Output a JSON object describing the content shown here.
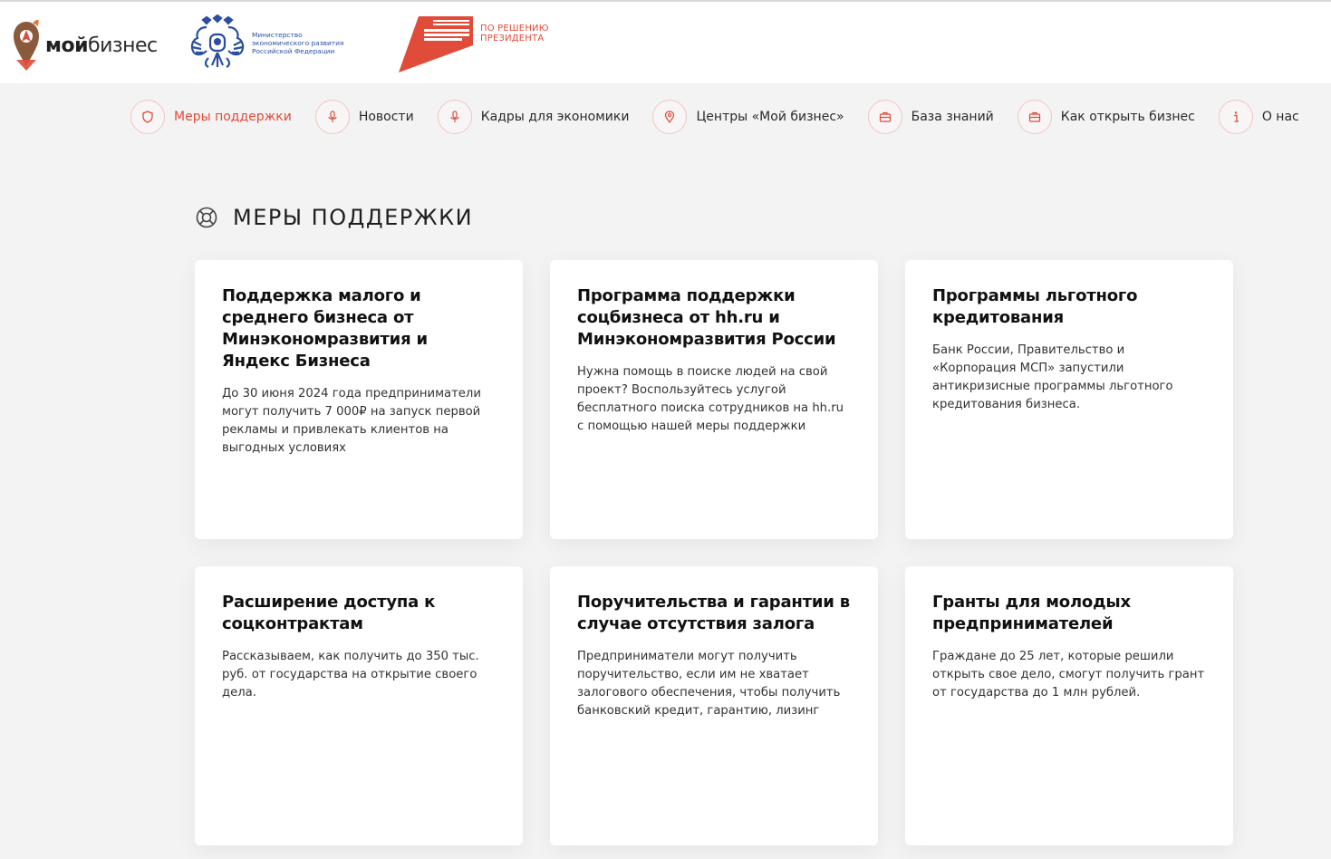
{
  "header": {
    "brand_bold": "мой",
    "brand_light": "бизнес",
    "ministry_text": "Министерство экономического развития Российской Федерации",
    "np_text": "ПО РЕШЕНИЮ ПРЕЗИДЕНТА",
    "np_logo_text": "МАЛОЕ И СРЕДНЕЕ ПРЕДПРИНИМАТЕЛЬСТВО НАЦИОНАЛЬНЫЕ ПРОЕКТЫ РОССИИ",
    "colors": {
      "accent": "#e04b3a",
      "ministry_blue": "#2a4ea0",
      "brand_brown": "#8b5a3c"
    }
  },
  "nav": {
    "items": [
      {
        "label": "Меры поддержки",
        "icon": "shield-icon",
        "active": true
      },
      {
        "label": "Новости",
        "icon": "microphone-icon",
        "active": false
      },
      {
        "label": "Кадры для экономики",
        "icon": "microphone-icon",
        "active": false
      },
      {
        "label": "Центры «Мой бизнес»",
        "icon": "location-pin-icon",
        "active": false
      },
      {
        "label": "База знаний",
        "icon": "briefcase-icon",
        "active": false
      },
      {
        "label": "Как открыть бизнес",
        "icon": "briefcase-icon",
        "active": false
      },
      {
        "label": "О нас",
        "icon": "info-icon",
        "active": false
      }
    ]
  },
  "main": {
    "title": "МЕРЫ ПОДДЕРЖКИ",
    "title_icon": "lifebuoy-icon",
    "cards": [
      {
        "title": "Поддержка малого и среднего бизнеса от Минэкономразвития и Яндекс Бизнеса",
        "text": "До 30 июня 2024 года предприниматели могут получить 7 000₽ на запуск первой рекламы и привлекать клиентов на выгодных условиях"
      },
      {
        "title": "Программа поддержки соцбизнеса от hh.ru и Минэкономразвития России",
        "text": "Нужна помощь в поиске людей на свой проект? Воспользуйтесь услугой бесплатного поиска сотрудников на hh.ru с помощью нашей меры поддержки"
      },
      {
        "title": "Программы льготного кредитования",
        "text": "Банк России, Правительство и «Корпорация МСП» запустили антикризисные программы льготного кредитования бизнеса."
      },
      {
        "title": "Расширение доступа к соцконтрактам",
        "text": "Рассказываем, как получить до 350 тыс. руб. от государства на открытие своего дела."
      },
      {
        "title": "Поручительства и гарантии в случае отсутствия залога",
        "text": "Предприниматели могут получить поручительство, если им не хватает залогового обеспечения, чтобы получить банковский кредит, гарантию, лизинг"
      },
      {
        "title": "Гранты для молодых предпринимателей",
        "text": "Граждане до 25 лет, которые решили открыть свое дело, смогут получить грант от государства до 1 млн рублей."
      }
    ]
  }
}
